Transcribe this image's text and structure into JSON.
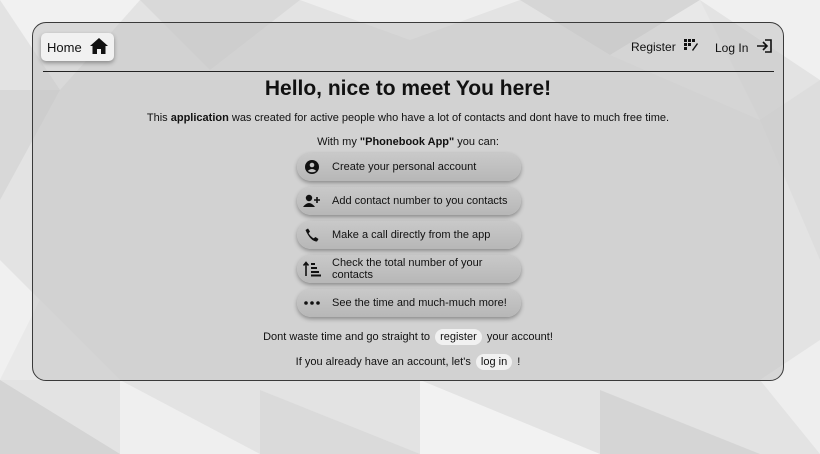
{
  "nav": {
    "home_label": "Home",
    "register_label": "Register",
    "login_label": "Log In"
  },
  "main": {
    "title": "Hello, nice to meet You here!",
    "intro_pre": "This ",
    "intro_bold": "application",
    "intro_post": " was created for active people who have a lot of contacts and dont have to much free time.",
    "with_pre": "With my ",
    "with_bold": "\"Phonebook App\"",
    "with_post": " you can:",
    "features": [
      {
        "label": "Create your personal account",
        "icon": "account-circle-icon"
      },
      {
        "label": "Add contact number to you contacts",
        "icon": "person-add-icon"
      },
      {
        "label": "Make a call directly from the app",
        "icon": "phone-icon"
      },
      {
        "label": "Check the total number of your contacts",
        "icon": "sort-numbers-icon"
      },
      {
        "label": "See the time and much-much more!",
        "icon": "more-dots-icon"
      }
    ],
    "cta1_pre": "Dont waste time and go straight to",
    "cta1_link": "register",
    "cta1_post": "your account!",
    "cta2_pre": "If you already have an account, let's",
    "cta2_link": "log in",
    "cta2_post": "!"
  }
}
